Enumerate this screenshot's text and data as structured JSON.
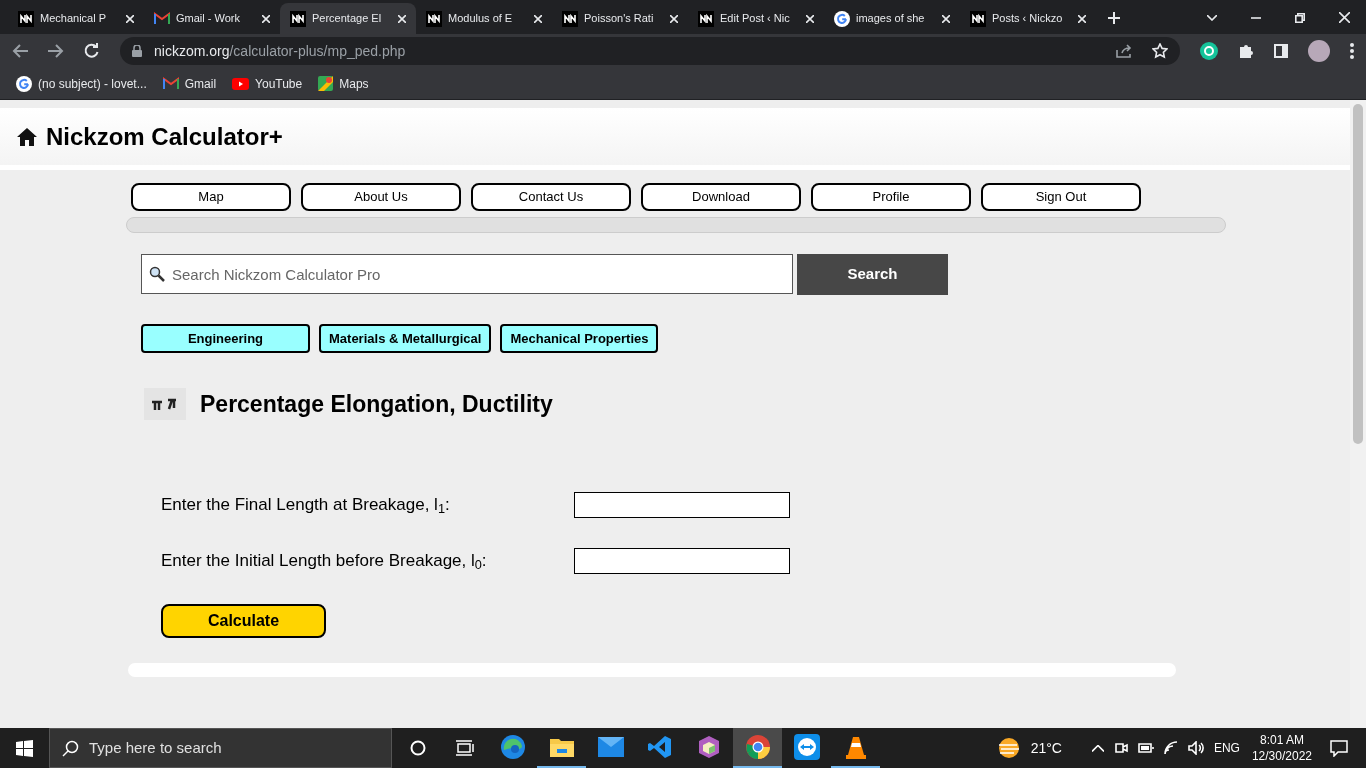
{
  "browser": {
    "tabs": [
      {
        "title": "Mechanical P",
        "kind": "site",
        "selected": false
      },
      {
        "title": "Gmail - Work",
        "kind": "gmail",
        "selected": false
      },
      {
        "title": "Percentage El",
        "kind": "site",
        "selected": true
      },
      {
        "title": "Modulus of E",
        "kind": "site",
        "selected": false
      },
      {
        "title": "Poisson's Rati",
        "kind": "site",
        "selected": false
      },
      {
        "title": "Edit Post ‹ Nic",
        "kind": "site",
        "selected": false
      },
      {
        "title": "images of she",
        "kind": "google",
        "selected": false
      },
      {
        "title": "Posts ‹ Nickzo",
        "kind": "site",
        "selected": false
      }
    ],
    "address": {
      "domain": "nickzom.org",
      "path": "/calculator-plus/mp_ped.php"
    },
    "bookmarks": [
      {
        "label": "(no subject) - lovet...",
        "kind": "google"
      },
      {
        "label": "Gmail",
        "kind": "gmail"
      },
      {
        "label": "YouTube",
        "kind": "youtube"
      },
      {
        "label": "Maps",
        "kind": "maps"
      }
    ]
  },
  "site": {
    "logo": "Nickzom Calculator+",
    "nav": [
      "Map",
      "About Us",
      "Contact Us",
      "Download",
      "Profile",
      "Sign Out"
    ],
    "search": {
      "placeholder": "Search Nickzom Calculator Pro",
      "button": "Search"
    },
    "breadcrumbs": [
      "Engineering",
      "Materials & Metallurgical",
      "Mechanical Properties"
    ],
    "title": "Percentage Elongation, Ductility",
    "fields": [
      {
        "label": "Enter the Final Length at Breakage, l$_{1}$:"
      },
      {
        "label": "Enter the Initial Length before Breakage, l$_{0}$:"
      }
    ],
    "calculate": "Calculate"
  },
  "taskbar": {
    "search_placeholder": "Type here to search",
    "apps": [
      {
        "kind": "edge",
        "selected": false,
        "open": false
      },
      {
        "kind": "explorer",
        "selected": false,
        "open": true
      },
      {
        "kind": "mail",
        "selected": false,
        "open": false
      },
      {
        "kind": "vscode",
        "selected": false,
        "open": false
      },
      {
        "kind": "box",
        "selected": false,
        "open": false
      },
      {
        "kind": "chrome",
        "selected": true,
        "open": true
      },
      {
        "kind": "teamviewer",
        "selected": false,
        "open": false
      },
      {
        "kind": "vlc",
        "selected": false,
        "open": true
      }
    ],
    "weather": "21°C",
    "language": "ENG",
    "time": "8:01 AM",
    "date": "12/30/2022"
  }
}
